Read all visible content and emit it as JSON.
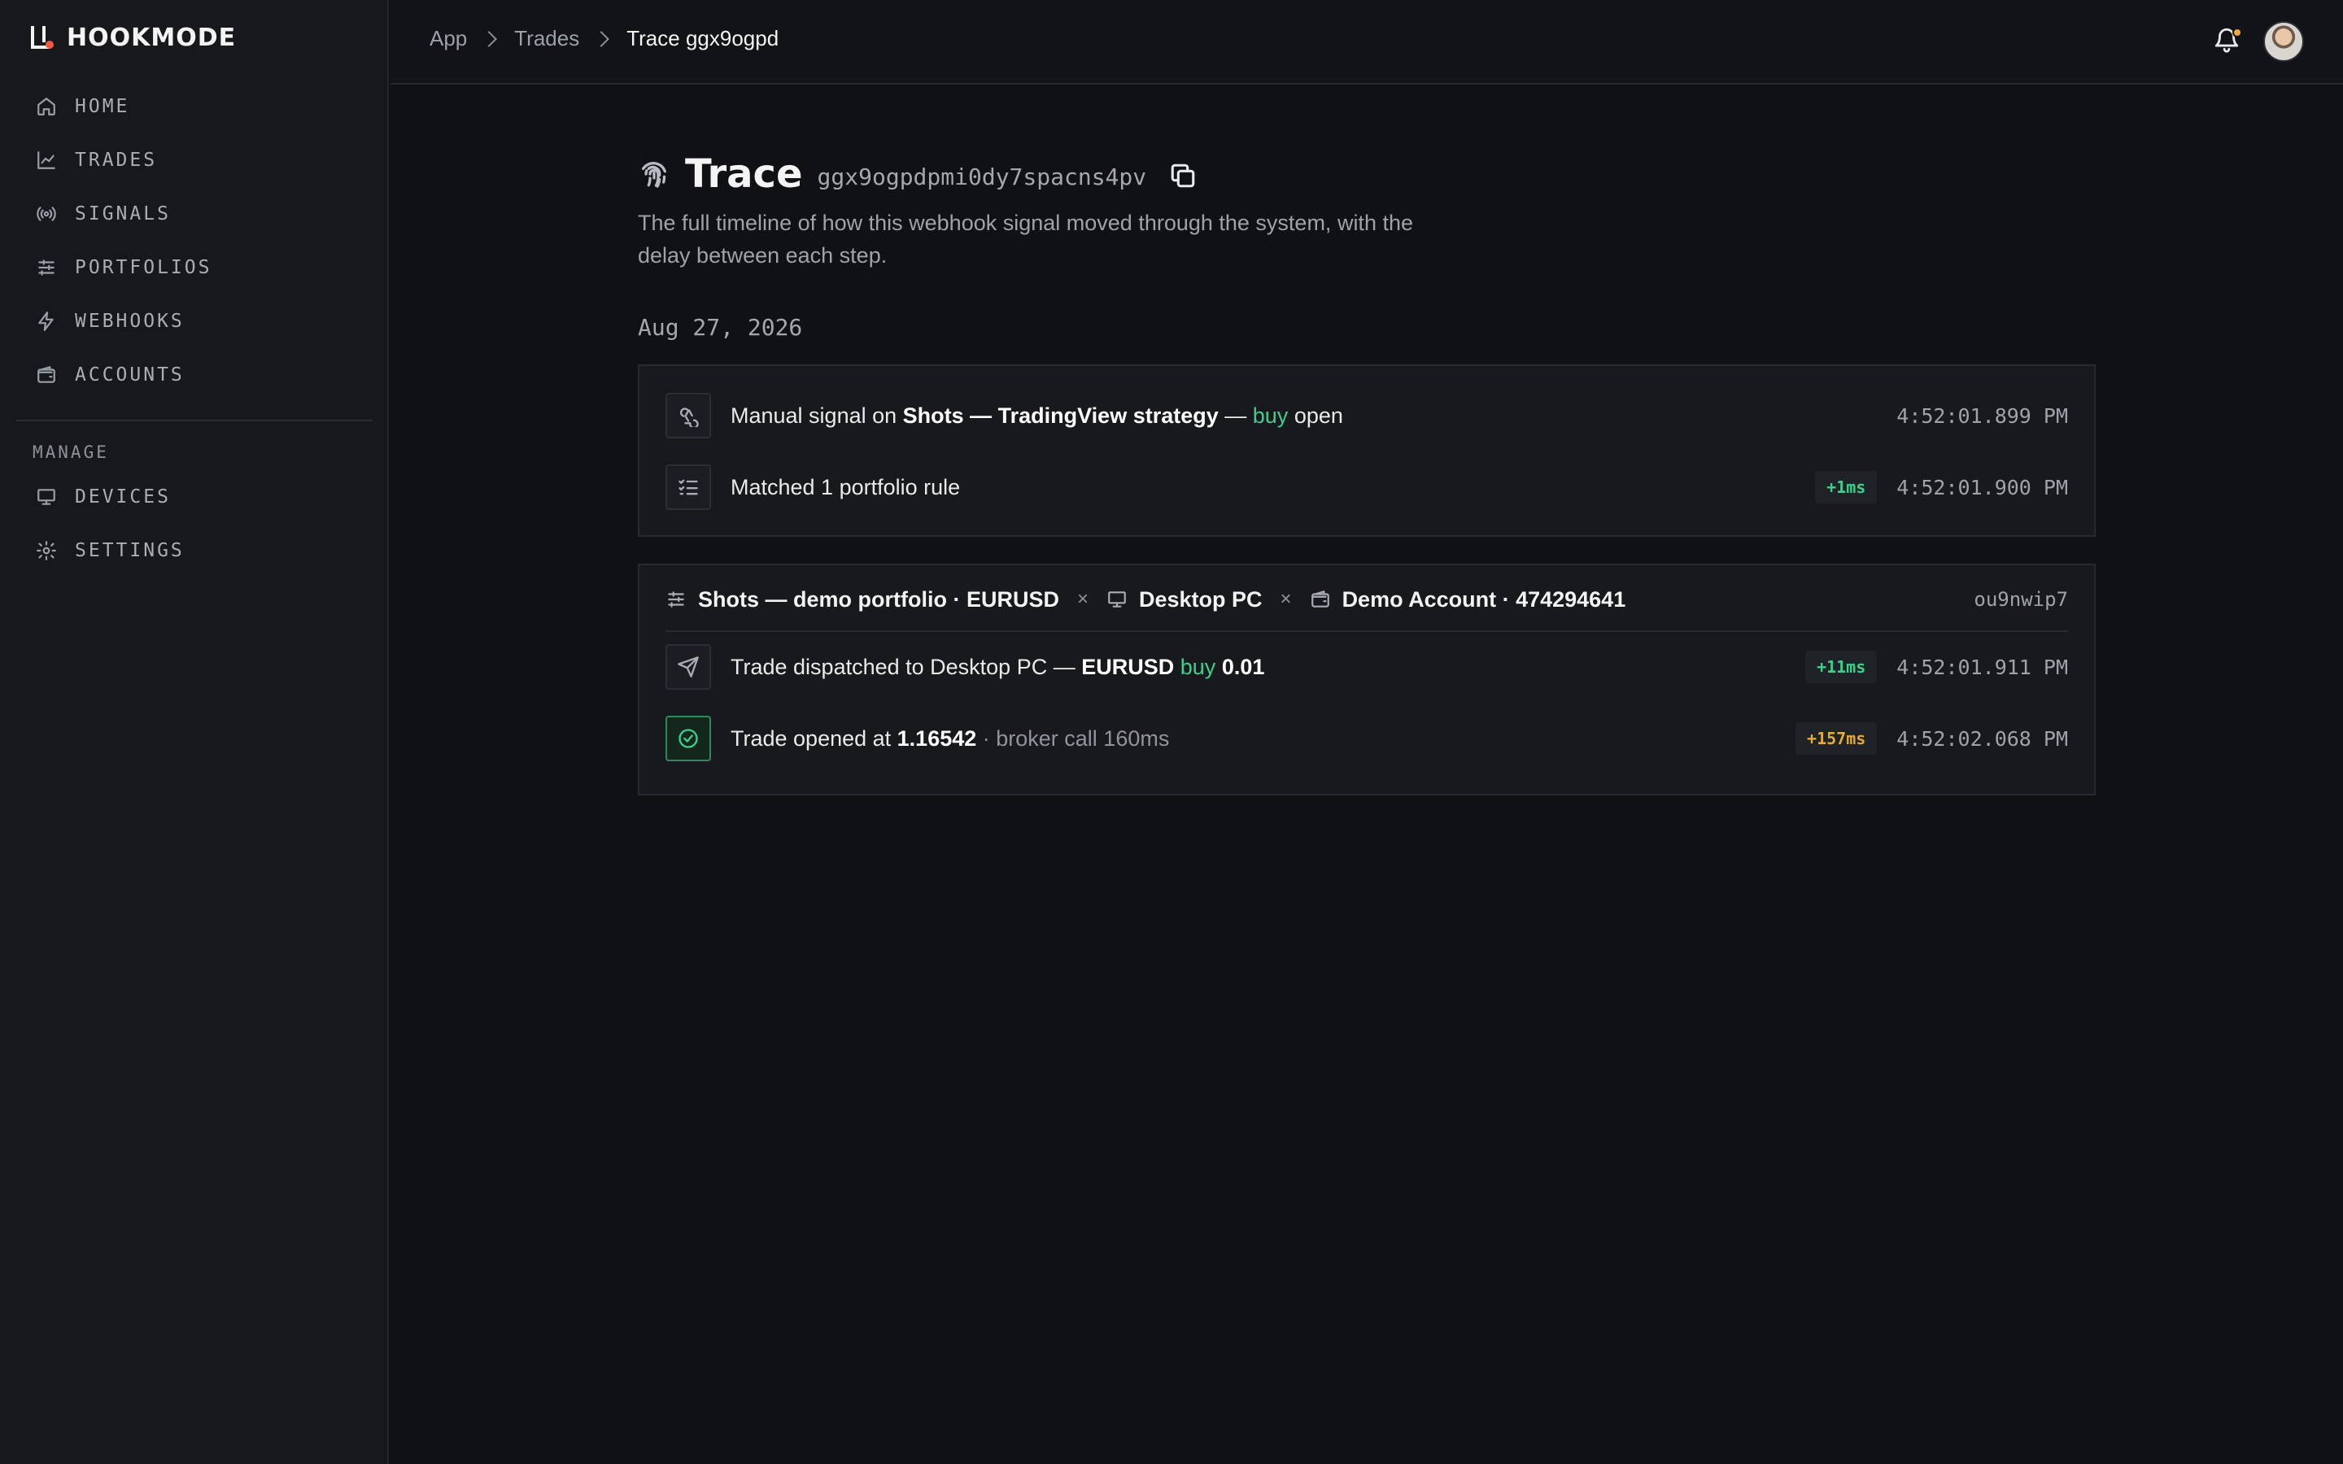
{
  "brand": {
    "name": "HOOKMODE"
  },
  "sidebar": {
    "items": [
      {
        "label": "HOME",
        "icon": "home-icon"
      },
      {
        "label": "TRADES",
        "icon": "chart-line-icon"
      },
      {
        "label": "SIGNALS",
        "icon": "broadcast-icon"
      },
      {
        "label": "PORTFOLIOS",
        "icon": "sliders-icon"
      },
      {
        "label": "WEBHOOKS",
        "icon": "bolt-icon"
      },
      {
        "label": "ACCOUNTS",
        "icon": "wallet-icon"
      }
    ],
    "section_label": "MANAGE",
    "manage_items": [
      {
        "label": "DEVICES",
        "icon": "monitor-icon"
      },
      {
        "label": "SETTINGS",
        "icon": "gear-icon"
      }
    ]
  },
  "topbar": {
    "breadcrumbs": [
      "App",
      "Trades",
      "Trace ggx9ogpd"
    ],
    "notification_dot_color": "#f0a83a"
  },
  "page": {
    "title": "Trace",
    "trace_id": "ggx9ogpdpmi0dy7spacns4pv",
    "subtitle": "The full timeline of how this webhook signal moved through the system, with the delay between each step.",
    "date": "Aug 27, 2026"
  },
  "signal_card": {
    "rows": [
      {
        "icon": "webhook-icon",
        "prefix": "Manual signal on ",
        "strategy": "Shots — TradingView strategy",
        "sep": " — ",
        "side": "buy",
        "action": " open",
        "time": "4:52:01.899 PM"
      },
      {
        "icon": "list-check-icon",
        "text": "Matched 1 portfolio rule",
        "delay": "+1ms",
        "time": "4:52:01.900 PM"
      }
    ]
  },
  "route_card": {
    "portfolio": "Shots — demo portfolio · EURUSD",
    "device": "Desktop PC",
    "account": "Demo Account · 474294641",
    "separator": "×",
    "route_id": "ou9nwip7",
    "rows": [
      {
        "icon": "send-icon",
        "prefix": "Trade dispatched to Desktop PC — ",
        "symbol": "EURUSD",
        "side": "buy",
        "qty": "0.01",
        "delay": "+11ms",
        "time": "4:52:01.911 PM"
      },
      {
        "icon": "check-circle-icon",
        "prefix": "Trade opened at ",
        "price": "1.16542",
        "suffix": " · broker call 160ms",
        "delay": "+157ms",
        "time": "4:52:02.068 PM"
      }
    ]
  },
  "colors": {
    "buy": "#3ecf8e",
    "delay_fast": "#3ecf8e",
    "delay_slow": "#e3a93a",
    "brand_dot": "#ef5b3f"
  }
}
